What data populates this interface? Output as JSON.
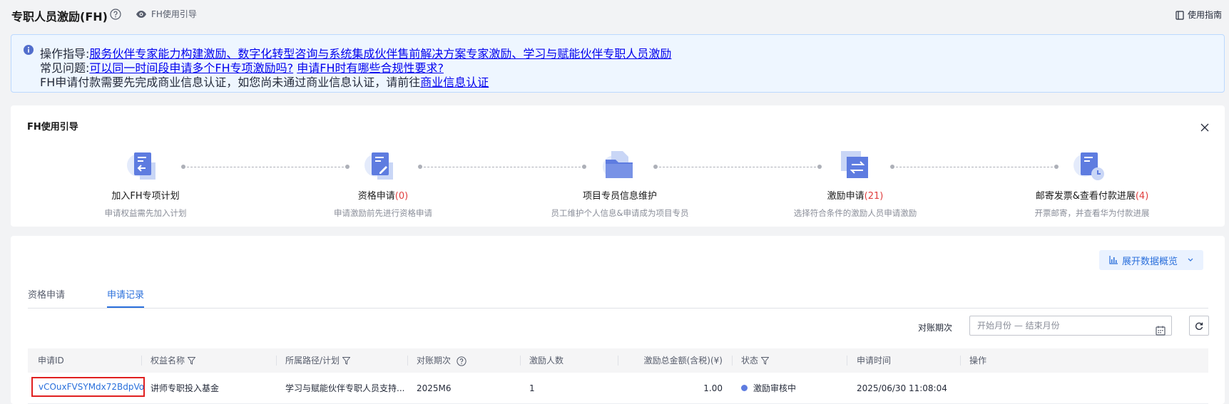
{
  "header": {
    "title": "专职人员激励(FH)",
    "guide_label": "FH使用引导",
    "manual_label": "使用指南"
  },
  "notice": {
    "line1_prefix": "操作指导:",
    "line1_link": "服务伙伴专家能力构建激励、数字化转型咨询与系统集成伙伴售前解决方案专家激励、学习与赋能伙伴专职人员激励",
    "line2_prefix": "常见问题:",
    "line2_link1": "可以同一时间段申请多个FH专项激励吗?",
    "line2_link2": "申请FH时有哪些合规性要求?",
    "line3_text": "FH申请付款需要先完成商业信息认证，如您尚未通过商业信息认证，请前往",
    "line3_link": "商业信息认证"
  },
  "guide_card": {
    "title": "FH使用引导",
    "steps": [
      {
        "name": "加入FH专项计划",
        "count": "",
        "desc": "申请权益需先加入计划"
      },
      {
        "name": "资格申请",
        "count": "(0)",
        "desc": "申请激励前先进行资格申请"
      },
      {
        "name": "项目专员信息维护",
        "count": "",
        "desc": "员工维护个人信息&申请成为项目专员"
      },
      {
        "name": "激励申请",
        "count": "(21)",
        "desc": "选择符合条件的激励人员申请激励"
      },
      {
        "name": "邮寄发票&查看付款进展",
        "count": "(4)",
        "desc": "开票邮寄，并查看华为付款进展"
      }
    ]
  },
  "records": {
    "expand_label": "展开数据概览",
    "tabs": [
      "资格申请",
      "申请记录"
    ],
    "period_label": "对账期次",
    "period_placeholder": "开始月份 — 结束月份",
    "columns": [
      "申请ID",
      "权益名称",
      "所属路径/计划",
      "对账期次",
      "激励人数",
      "激励总金额(含税)(¥)",
      "状态",
      "申请时间",
      "操作"
    ],
    "rows": [
      {
        "id": "vCOuxFVSYMdx72BdpVo",
        "benefit": "讲师专职投入基金",
        "path": "学习与赋能伙伴专职人员支持...",
        "period": "2025M6",
        "people": "1",
        "amount": "1.00",
        "status": "激励审核中",
        "time": "2025/06/30 11:08:04",
        "action": ""
      }
    ]
  },
  "colors": {
    "accent": "#2a6fdb",
    "count_red": "#e03e3e",
    "status_dot": "#5e7ce0",
    "highlight_border": "#e02020"
  }
}
